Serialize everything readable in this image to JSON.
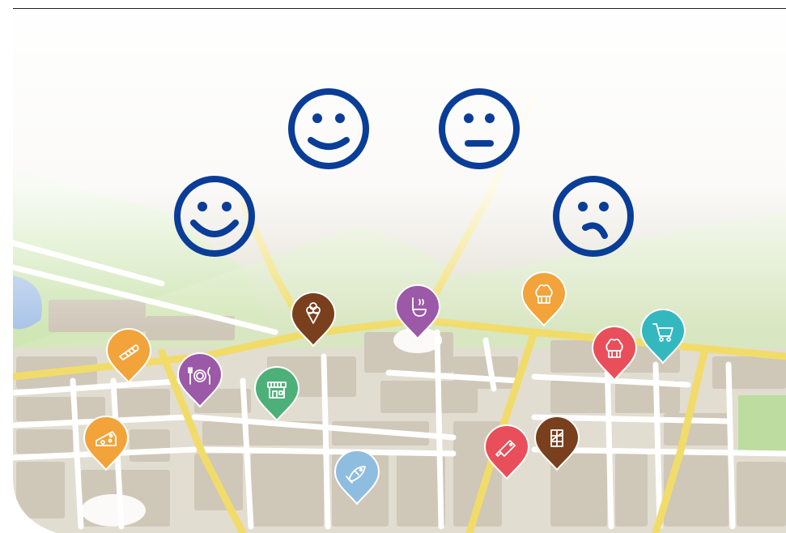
{
  "scene": {
    "kind": "city map with food location pins and satisfaction faces",
    "colors": {
      "background": "#ffffff",
      "block": "#d8d2c6",
      "block_light": "#e6e1d7",
      "road_main": "#f2df70",
      "road_minor": "#ffffff",
      "park": "#cde7b2",
      "water": "#a9c4e8",
      "face": "#0a3d97"
    }
  },
  "faces": [
    {
      "name": "big-smile-face-icon",
      "mood": "very happy"
    },
    {
      "name": "smile-face-icon",
      "mood": "happy"
    },
    {
      "name": "neutral-face-icon",
      "mood": "neutral"
    },
    {
      "name": "sad-face-icon",
      "mood": "unhappy"
    }
  ],
  "pins": [
    {
      "name": "ice-cream-pin-icon",
      "icon": "ice-cream",
      "color": "#7a3f1c"
    },
    {
      "name": "soup-ladle-pin-icon",
      "icon": "soup-ladle",
      "color": "#9b59a7"
    },
    {
      "name": "chef-hat-pin-icon",
      "icon": "chef-hat",
      "color": "#f2a33a"
    },
    {
      "name": "chef-hat-red-pin-icon",
      "icon": "chef-hat",
      "color": "#e84f5a"
    },
    {
      "name": "shopping-cart-pin-icon",
      "icon": "shopping-cart",
      "color": "#33b8c0"
    },
    {
      "name": "bread-pin-icon",
      "icon": "bread",
      "color": "#f2a33a"
    },
    {
      "name": "restaurant-pin-icon",
      "icon": "plate-cutlery",
      "color": "#9b59a7"
    },
    {
      "name": "grocery-store-pin-icon",
      "icon": "storefront",
      "color": "#4db079"
    },
    {
      "name": "cheese-pin-icon",
      "icon": "cheese",
      "color": "#f2a33a"
    },
    {
      "name": "fish-pin-icon",
      "icon": "fish",
      "color": "#8fbde0"
    },
    {
      "name": "butcher-knife-pin-icon",
      "icon": "cleaver",
      "color": "#e84f5a"
    },
    {
      "name": "chocolate-pin-icon",
      "icon": "chocolate",
      "color": "#7a3f1c"
    }
  ]
}
